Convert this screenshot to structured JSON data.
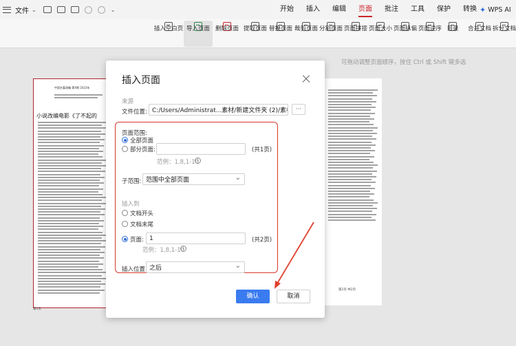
{
  "menubar": {
    "file_label": "文件",
    "tabs": [
      {
        "label": "开始"
      },
      {
        "label": "插入"
      },
      {
        "label": "编辑"
      },
      {
        "label": "页面"
      },
      {
        "label": "批注"
      },
      {
        "label": "工具"
      },
      {
        "label": "保护"
      },
      {
        "label": "转换"
      }
    ],
    "active_tab": "页面",
    "ai_label": "WPS AI"
  },
  "ribbon": {
    "items": [
      {
        "label": "插入空白页",
        "icon": "blank-page-icon"
      },
      {
        "label": "导入页面",
        "icon": "import-page-icon"
      },
      {
        "label": "删除页面",
        "icon": "delete-page-icon"
      },
      {
        "label": "提取页面",
        "icon": "extract-page-icon"
      },
      {
        "label": "替换页面",
        "icon": "replace-page-icon"
      },
      {
        "label": "裁剪页面",
        "icon": "crop-page-icon"
      },
      {
        "label": "分割页面",
        "icon": "split-page-icon"
      },
      {
        "label": "页面拼接",
        "icon": "merge-pages-icon"
      },
      {
        "label": "页面大小",
        "icon": "page-size-icon"
      },
      {
        "label": "页面纵偏",
        "icon": "page-offset-icon"
      },
      {
        "label": "页面逆序",
        "icon": "reverse-pages-icon"
      },
      {
        "label": "目录",
        "icon": "toc-icon"
      },
      {
        "label": "合并文档",
        "icon": "merge-docs-icon"
      },
      {
        "label": "拆分文档",
        "icon": "split-doc-icon"
      }
    ]
  },
  "hint": "可拖动调整页面顺序，按住 Ctrl 或 Shift 键多选",
  "doc": {
    "left_title": "小说改编电影《了不起的",
    "left_header": "中国名著改编 第X期 2023年",
    "right_footer": "第2页 共2页",
    "left_bottom": "第1页",
    "right_bottom": "第2页"
  },
  "dialog": {
    "title": "插入页面",
    "source_section": "来源",
    "file_location_label": "文件位置:",
    "file_path": "C:/Users/Administrat...素材/新建文件夹 (2)/素材1.pdf",
    "browse_label": "···",
    "page_range_label": "页面范围:",
    "all_pages": "全部页面",
    "partial_pages": "部分页面:",
    "partial_value": "",
    "partial_total": "(共1页)",
    "partial_example": "范例：1,8,1-10",
    "subrange_label": "子范围:",
    "subrange_value": "范围中全部页面",
    "insert_to_section": "插入到",
    "doc_start": "文档开头",
    "doc_end": "文档末尾",
    "page_label": "页面:",
    "page_value": "1",
    "page_total": "(共2页)",
    "page_example": "范例：1,8,1-10",
    "position_label": "插入位置:",
    "position_value": "之后",
    "ok_label": "确认",
    "cancel_label": "取消"
  },
  "colors": {
    "accent": "#c9252c",
    "primary": "#3a7bf0",
    "highlight": "#d8392b"
  }
}
